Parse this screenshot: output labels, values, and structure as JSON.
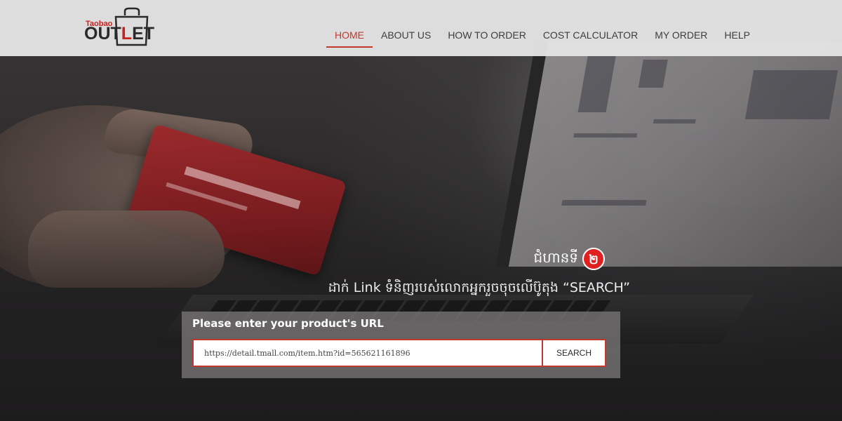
{
  "brand": {
    "logo_small": "Taobao",
    "logo_big_prefix": "OUT",
    "logo_big_accent": "L",
    "logo_big_suffix": "ET",
    "accent_color": "#c0392b"
  },
  "nav": {
    "items": [
      {
        "label": "HOME",
        "active": true
      },
      {
        "label": "ABOUT US",
        "active": false
      },
      {
        "label": "HOW TO ORDER",
        "active": false
      },
      {
        "label": "COST CALCULATOR",
        "active": false
      },
      {
        "label": "MY ORDER",
        "active": false
      },
      {
        "label": "HELP",
        "active": false
      }
    ]
  },
  "hero": {
    "step_text": "ជំហានទី",
    "step_number": "២",
    "instruction": "ដាក់ Link ទំនិញរបស់លោកអ្នករួចចុចលើប៊ូតុង “SEARCH”"
  },
  "search": {
    "label": "Please enter your product's URL",
    "value": "https://detail.tmall.com/item.htm?id=565621161896",
    "button_label": "SEARCH"
  }
}
